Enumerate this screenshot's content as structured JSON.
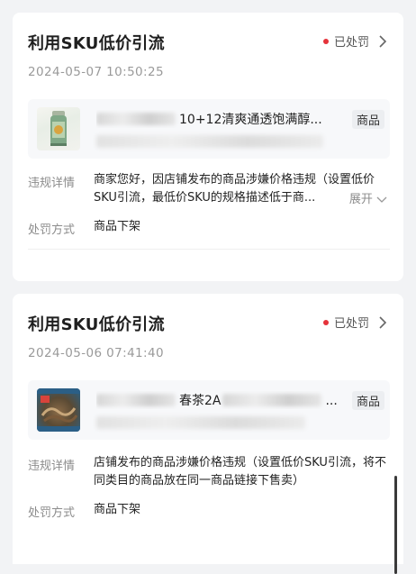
{
  "records": [
    {
      "title": "利用SKU低价引流",
      "status": "已处罚",
      "date": "2024-05-07 10:50:25",
      "product_name": "10+12清爽通透饱满醇...",
      "product_tag": "商品",
      "violation_label": "违规详情",
      "violation_text": "商家您好，因店铺发布的商品涉嫌价格违规（设置低价SKU引流，最低价SKU的规格描述低于商...",
      "expand_label": "展开",
      "penalty_label": "处罚方式",
      "penalty_value": "商品下架"
    },
    {
      "title": "利用SKU低价引流",
      "status": "已处罚",
      "date": "2024-05-06 07:41:40",
      "product_name": "春茶2A",
      "product_name_tail": "...",
      "product_tag": "商品",
      "violation_label": "违规详情",
      "violation_text": "店铺发布的商品涉嫌价格违规（设置低价SKU引流，将不同类目的商品放在同一商品链接下售卖）",
      "penalty_label": "处罚方式",
      "penalty_value": "商品下架"
    }
  ],
  "colors": {
    "status_dot": "#e5323a",
    "page_bg": "#f2f3f5"
  },
  "icons": {
    "status_dot": "red-dot",
    "chevron": "chevron-right-icon",
    "expand": "chevron-down-icon"
  }
}
